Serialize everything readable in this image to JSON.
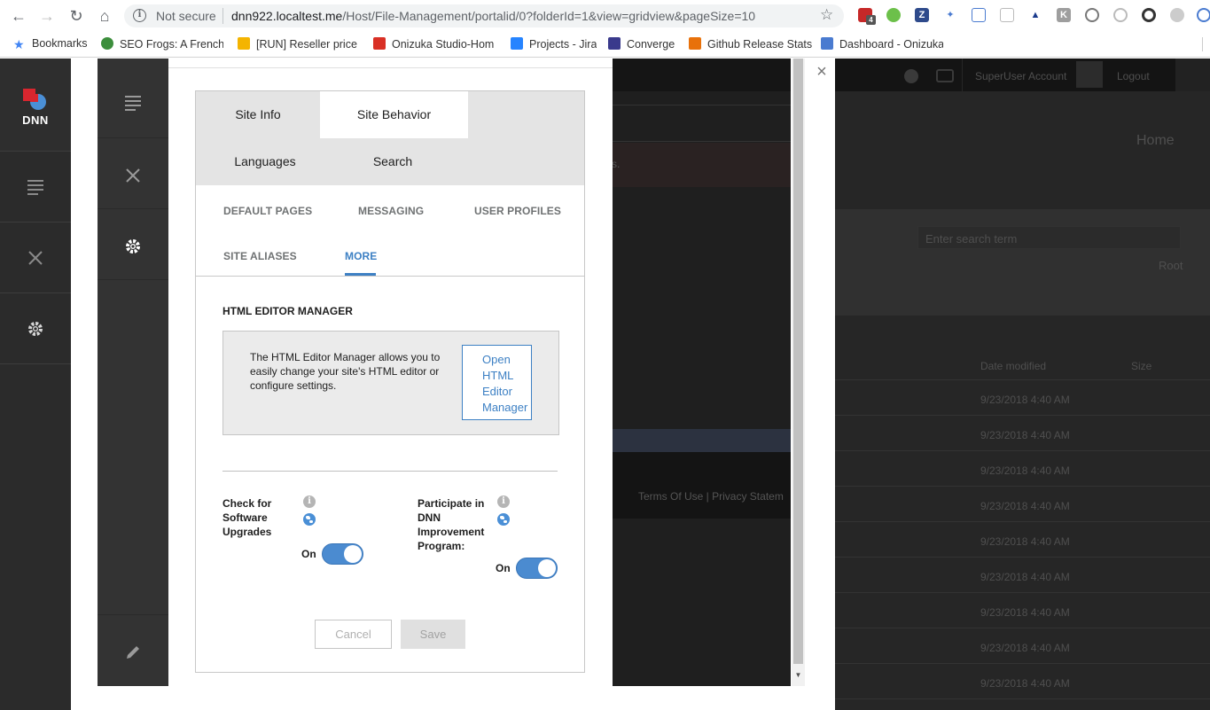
{
  "browser": {
    "security_label": "Not secure",
    "url_host": "dnn922.localtest.me",
    "url_path": "/Host/File-Management/portalid/0?folderId=1&view=gridview&pageSize=10",
    "extension_badge": "4",
    "bookmarks": [
      {
        "label": "Bookmarks",
        "color": "#4285f4"
      },
      {
        "label": "SEO Frogs: A French ",
        "color": "#3c8e3c"
      },
      {
        "label": "[RUN] Reseller price c",
        "color": "#f4b400"
      },
      {
        "label": "Onizuka Studio-Hom",
        "color": "#d93025"
      },
      {
        "label": "Projects - Jira",
        "color": "#2684ff"
      },
      {
        "label": "Converge",
        "color": "#3a3a8c"
      },
      {
        "label": "Github Release Stats",
        "color": "#e8710a"
      },
      {
        "label": "Dashboard - Onizuka",
        "color": "#4a7bd0"
      }
    ]
  },
  "dnn": {
    "logo_text": "DNN"
  },
  "background": {
    "top_links": [
      "SuperUser Account",
      "Logout"
    ],
    "nav_home": "Home",
    "search_placeholder": "Enter search term",
    "folder_root": "Root",
    "col_date": "Date modified",
    "col_size": "Size",
    "row_date": "9/23/2018 4:40 AM",
    "footer_links": "Terms Of Use | Privacy Statem",
    "message_tail": "s."
  },
  "settings": {
    "tabs": [
      {
        "label": "Site Info"
      },
      {
        "label": "Site Behavior"
      },
      {
        "label": "Languages"
      },
      {
        "label": "Search"
      }
    ],
    "active_tab": "Site Behavior",
    "subtabs": [
      {
        "label": "DEFAULT PAGES"
      },
      {
        "label": "MESSAGING"
      },
      {
        "label": "USER PROFILES"
      },
      {
        "label": "SITE ALIASES"
      },
      {
        "label": "MORE"
      }
    ],
    "active_subtab": "MORE",
    "section_title": "HTML EDITOR MANAGER",
    "info_text": "The HTML Editor Manager allows you to easily change your site's HTML editor or configure settings.",
    "open_button": [
      "Open",
      "HTML",
      "Editor",
      "Manager"
    ],
    "options": [
      {
        "label": [
          "Check for",
          "Software",
          "Upgrades"
        ],
        "toggle_label": "On",
        "value": true
      },
      {
        "label": [
          "Participate in",
          "DNN",
          "Improvement",
          "Program:"
        ],
        "toggle_label": "On",
        "value": true
      }
    ],
    "cancel_label": "Cancel",
    "save_label": "Save"
  },
  "colors": {
    "accent": "#3d80c4",
    "toggle_on": "#4b8bd0",
    "persona_bar": "#333333"
  }
}
